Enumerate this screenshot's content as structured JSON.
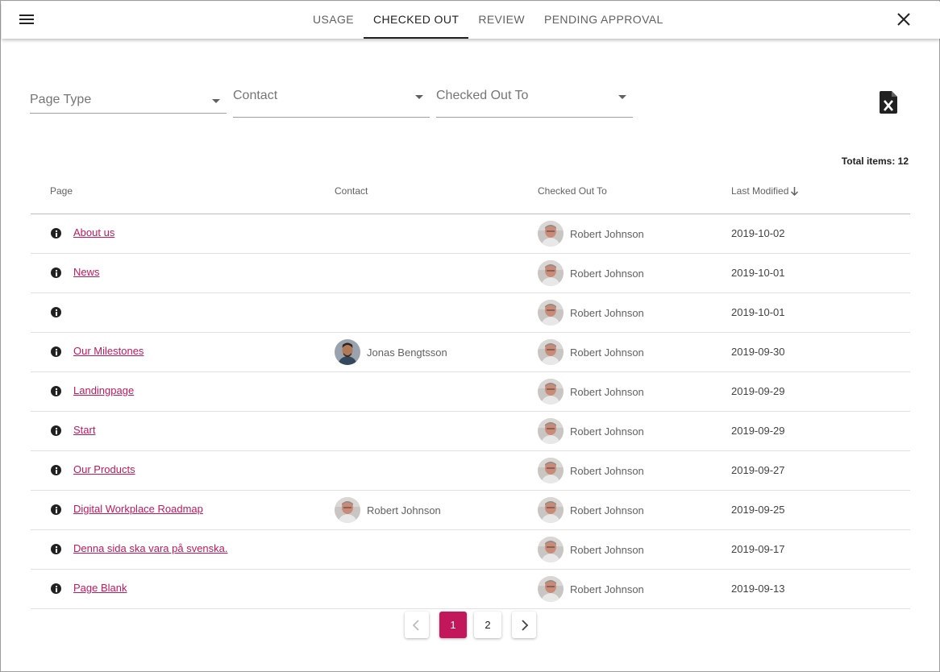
{
  "header": {
    "tabs": [
      {
        "label": "USAGE"
      },
      {
        "label": "CHECKED OUT"
      },
      {
        "label": "REVIEW"
      },
      {
        "label": "PENDING APPROVAL"
      }
    ]
  },
  "filters": {
    "page_type": "Page Type",
    "contact": "Contact",
    "checked_out_to": "Checked Out To"
  },
  "total_items": "Total items: 12",
  "table": {
    "headers": {
      "page": "Page",
      "contact": "Contact",
      "checked_out_to": "Checked Out To",
      "last_modified": "Last Modified"
    },
    "rows": [
      {
        "page": "About us",
        "contact": "",
        "checked_out_to": "Robert Johnson",
        "last_modified": "2019-10-02"
      },
      {
        "page": "News",
        "contact": "",
        "checked_out_to": "Robert Johnson",
        "last_modified": "2019-10-01"
      },
      {
        "page": "",
        "contact": "",
        "checked_out_to": "Robert Johnson",
        "last_modified": "2019-10-01"
      },
      {
        "page": "Our Milestones",
        "contact": "Jonas Bengtsson",
        "checked_out_to": "Robert Johnson",
        "last_modified": "2019-09-30"
      },
      {
        "page": "Landingpage",
        "contact": "",
        "checked_out_to": "Robert Johnson",
        "last_modified": "2019-09-29"
      },
      {
        "page": "Start",
        "contact": "",
        "checked_out_to": "Robert Johnson",
        "last_modified": "2019-09-29"
      },
      {
        "page": "Our Products",
        "contact": "",
        "checked_out_to": "Robert Johnson",
        "last_modified": "2019-09-27"
      },
      {
        "page": "Digital Workplace Roadmap",
        "contact": "Robert Johnson",
        "checked_out_to": "Robert Johnson",
        "last_modified": "2019-09-25"
      },
      {
        "page": "Denna sida ska vara på svenska.",
        "contact": "",
        "checked_out_to": "Robert Johnson",
        "last_modified": "2019-09-17"
      },
      {
        "page": "Page Blank",
        "contact": "",
        "checked_out_to": "Robert Johnson",
        "last_modified": "2019-09-13"
      }
    ]
  },
  "pagination": {
    "pages": [
      "1",
      "2"
    ],
    "current": "1"
  },
  "icons": {
    "menu": "menu-icon",
    "close": "close-icon",
    "export": "excel-export-icon",
    "sort": "arrow-down-icon",
    "info": "info-icon",
    "prev": "chevron-left-icon",
    "next": "chevron-right-icon"
  },
  "colors": {
    "accent": "#c2185b",
    "text": "#212121",
    "muted": "#757575"
  }
}
